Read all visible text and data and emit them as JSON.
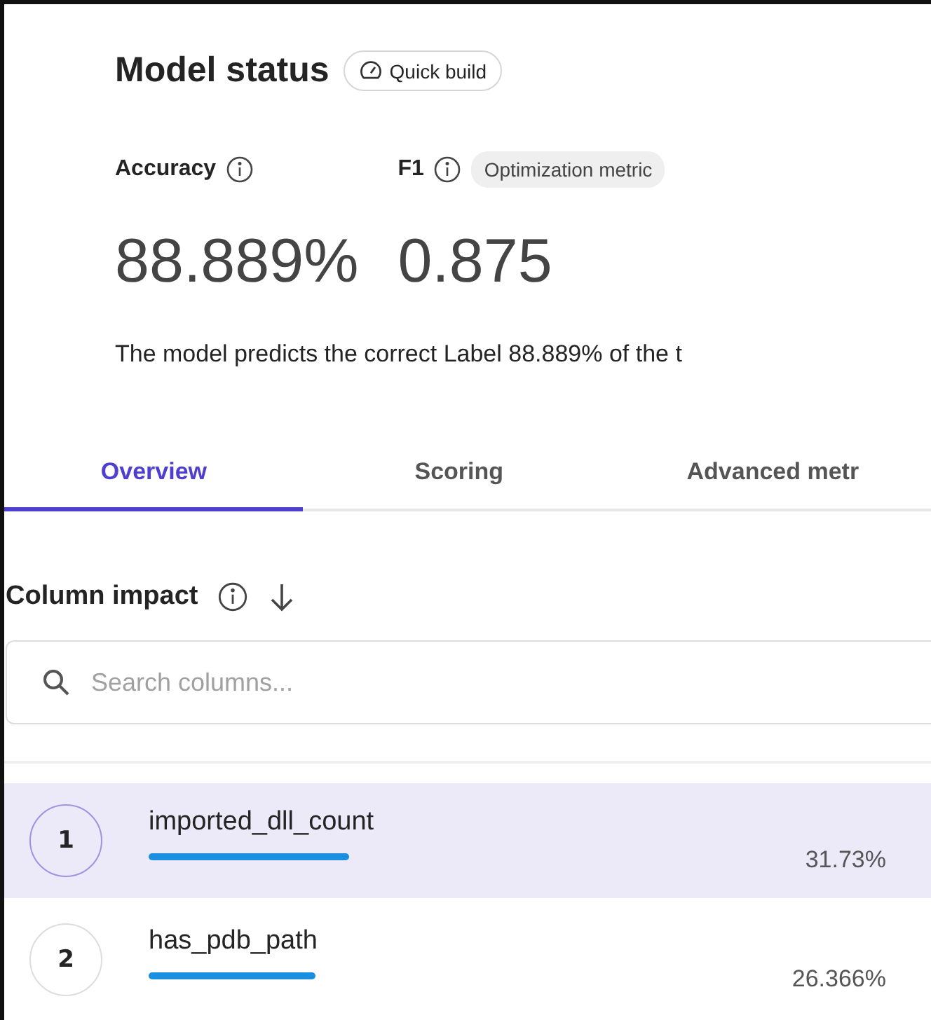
{
  "header": {
    "title": "Model status",
    "badge": "Quick build"
  },
  "metrics": [
    {
      "label": "Accuracy",
      "value": "88.889%"
    },
    {
      "label": "F1",
      "value": "0.875",
      "tag": "Optimization metric"
    }
  ],
  "description": "The model predicts the correct Label 88.889% of the t",
  "tabs": [
    {
      "label": "Overview",
      "selected": true
    },
    {
      "label": "Scoring",
      "selected": false
    },
    {
      "label": "Advanced metr",
      "selected": false
    }
  ],
  "column_impact": {
    "title": "Column impact",
    "search": {
      "placeholder": "Search columns..."
    },
    "rows": [
      {
        "rank": "1",
        "name": "imported_dll_count",
        "level": 0.3173,
        "reading": "31.73%",
        "selected": true
      },
      {
        "rank": "2",
        "name": "has_pdb_path",
        "level": 0.2637,
        "reading": "26.366%",
        "selected": false
      }
    ]
  }
}
